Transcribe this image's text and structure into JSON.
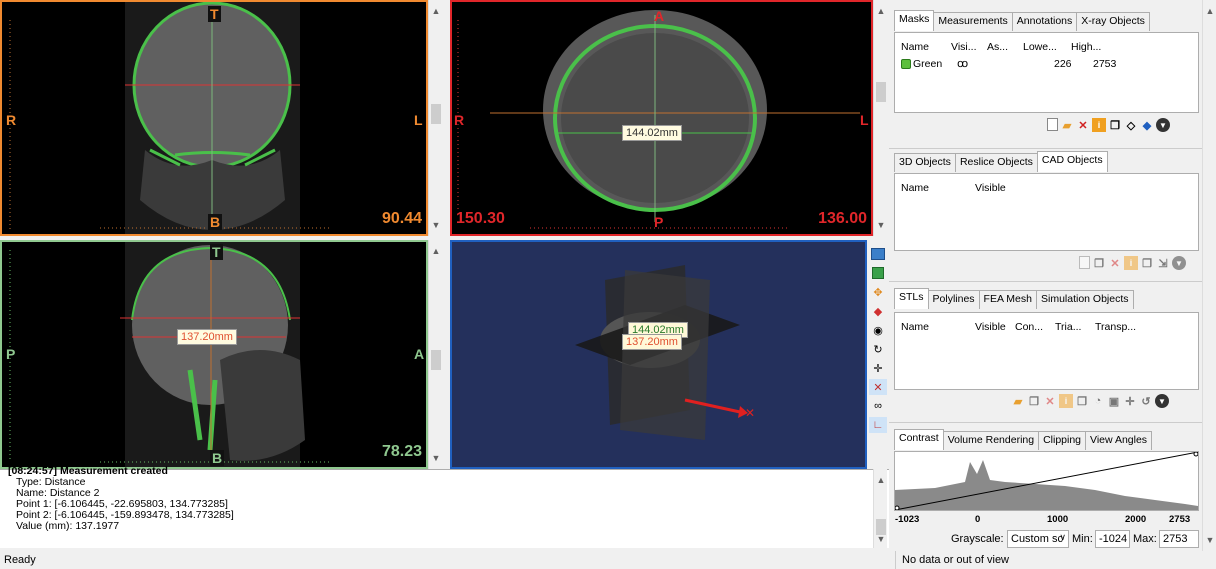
{
  "viewports": {
    "coronal": {
      "top": "T",
      "bottom": "B",
      "left": "R",
      "right": "L",
      "value": "90.44",
      "border_color": "#f08a30"
    },
    "axial": {
      "top": "A",
      "bottom": "P",
      "left": "R",
      "right": "L",
      "value_left": "150.30",
      "value_right": "136.00",
      "measurement": "144.02mm",
      "border_color": "#e0262a"
    },
    "sagittal": {
      "top": "T",
      "bottom": "B",
      "left": "P",
      "right": "A",
      "value": "78.23",
      "measurement": "137.20mm",
      "border_color": "#8fc88f"
    },
    "view3d": {
      "measurement_green": "144.02mm",
      "measurement_red": "137.20mm",
      "background": "#24305c"
    }
  },
  "log": {
    "header": "[08:24:57] Measurement created",
    "lines": [
      "Type: Distance",
      "Name: Distance 2",
      "Point 1: [-6.106445, -22.695803, 134.773285]",
      "Point 2: [-6.106445, -159.893478, 134.773285]",
      "Value (mm): 137.1977"
    ]
  },
  "status": {
    "left": "Ready",
    "right": "No data or out of view"
  },
  "masks_panel": {
    "tabs": [
      "Masks",
      "Measurements",
      "Annotations",
      "X-ray Objects"
    ],
    "columns": [
      "Name",
      "Visi...",
      "As...",
      "Lowe...",
      "High..."
    ],
    "rows": [
      {
        "name": "Green",
        "lower": "226",
        "higher": "2753",
        "color": "#5cbf3c"
      }
    ]
  },
  "objects_panel": {
    "tabs": [
      "3D Objects",
      "Reslice Objects",
      "CAD Objects"
    ],
    "columns": [
      "Name",
      "Visible"
    ]
  },
  "stl_panel": {
    "tabs": [
      "STLs",
      "Polylines",
      "FEA Mesh",
      "Simulation Objects"
    ],
    "columns": [
      "Name",
      "Visible",
      "Con...",
      "Tria...",
      "Transp..."
    ]
  },
  "contrast_panel": {
    "tabs": [
      "Contrast",
      "Volume Rendering",
      "Clipping",
      "View Angles"
    ],
    "axis_ticks": [
      "-1023",
      "0",
      "1000",
      "2000",
      "2753"
    ],
    "grayscale_label": "Grayscale:",
    "grayscale_value": "Custom sc",
    "min_label": "Min:",
    "min_value": "-1024",
    "max_label": "Max:",
    "max_value": "2753"
  },
  "icons": {
    "masks": [
      "new-icon",
      "open-icon",
      "delete-icon",
      "info-icon",
      "copy-icon",
      "erase-icon",
      "shield-icon",
      "menu-icon"
    ],
    "toolbar": [
      "cube-icon",
      "box-icon",
      "clip-icon",
      "shield-icon",
      "eye-icon",
      "rotate-icon",
      "move-icon",
      "crosshair-icon",
      "glasses-icon",
      "axes-icon"
    ]
  }
}
